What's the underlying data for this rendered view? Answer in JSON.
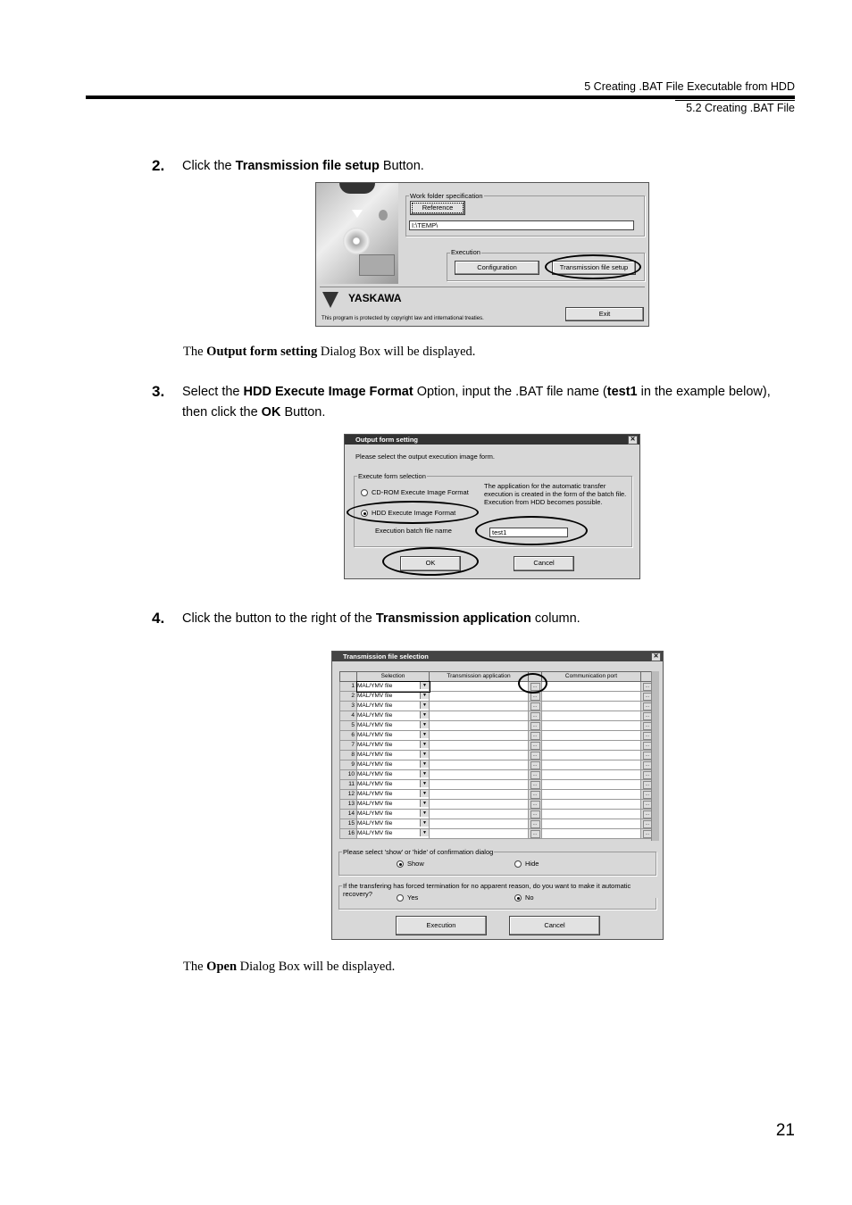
{
  "header": {
    "chapter": "5  Creating .BAT File Executable from HDD",
    "section": "5.2  Creating .BAT File"
  },
  "steps": [
    {
      "number": "2.",
      "pre": "Click the ",
      "bold": "Transmission file setup",
      "post": " Button."
    },
    {
      "number": "3.",
      "pre": "Select the ",
      "bold1": "HDD Execute Image Format",
      "mid1": " Option, input the .BAT file name (",
      "bold2": "test1",
      "mid2": " in the example below),",
      "line2_pre": "then click the ",
      "bold3": "OK",
      "post": " Button."
    },
    {
      "number": "4.",
      "pre": "Click the button to the right of the ",
      "bold": "Transmission application",
      "post": " column."
    }
  ],
  "notes": [
    {
      "pre": "The ",
      "bold": "Output form setting",
      "post": " Dialog Box will be displayed."
    },
    {
      "pre": "The ",
      "bold": "Open",
      "post": " Dialog Box will be displayed."
    }
  ],
  "shot1": {
    "work_folder_label": "Work folder specification",
    "reference_button": "Reference",
    "folder_value": "I:\\TEMP\\",
    "execution_label": "Execution",
    "configuration_button": "Configuration",
    "transmission_button": "Transmission file setup",
    "brand": "YASKAWA",
    "copyright": "This program is protected by copyright law and international treaties.",
    "exit_button": "Exit"
  },
  "shot2": {
    "title": "Output form setting",
    "close": "✕",
    "prompt": "Please select the output execution image form.",
    "group_label": "Execute form selection",
    "option_cdrom": "CD-ROM Execute Image Format",
    "option_hdd": "HDD Execute Image Format",
    "description": "The application for the automatic transfer execution is created in the form of the batch file. Execution from HDD becomes possible.",
    "batch_label": "Execution batch file name",
    "batch_value": "test1",
    "ok_button": "OK",
    "cancel_button": "Cancel"
  },
  "shot3": {
    "title": "Transmission file selection",
    "close": "✕",
    "columns": [
      "Selection",
      "Transmission application",
      "Communication port"
    ],
    "rows": [
      {
        "num": "1",
        "selection": "MAL/YMV file"
      },
      {
        "num": "2",
        "selection": "MAL/YMV file"
      },
      {
        "num": "3",
        "selection": "MAL/YMV file"
      },
      {
        "num": "4",
        "selection": "MAL/YMV file"
      },
      {
        "num": "5",
        "selection": "MAL/YMV file"
      },
      {
        "num": "6",
        "selection": "MAL/YMV file"
      },
      {
        "num": "7",
        "selection": "MAL/YMV file"
      },
      {
        "num": "8",
        "selection": "MAL/YMV file"
      },
      {
        "num": "9",
        "selection": "MAL/YMV file"
      },
      {
        "num": "10",
        "selection": "MAL/YMV file"
      },
      {
        "num": "11",
        "selection": "MAL/YMV file"
      },
      {
        "num": "12",
        "selection": "MAL/YMV file"
      },
      {
        "num": "13",
        "selection": "MAL/YMV file"
      },
      {
        "num": "14",
        "selection": "MAL/YMV file"
      },
      {
        "num": "15",
        "selection": "MAL/YMV file"
      },
      {
        "num": "16",
        "selection": "MAL/YMV file"
      }
    ],
    "confirm_label": "Please select 'show' or 'hide' of confirmation dialog",
    "show_option": "Show",
    "hide_option": "Hide",
    "recovery_label": "If the transfering has forced termination for no apparent reason, do you want to make it automatic recovery?",
    "yes_option": "Yes",
    "no_option": "No",
    "execution_button": "Execution",
    "cancel_button": "Cancel"
  },
  "page_number": "21"
}
